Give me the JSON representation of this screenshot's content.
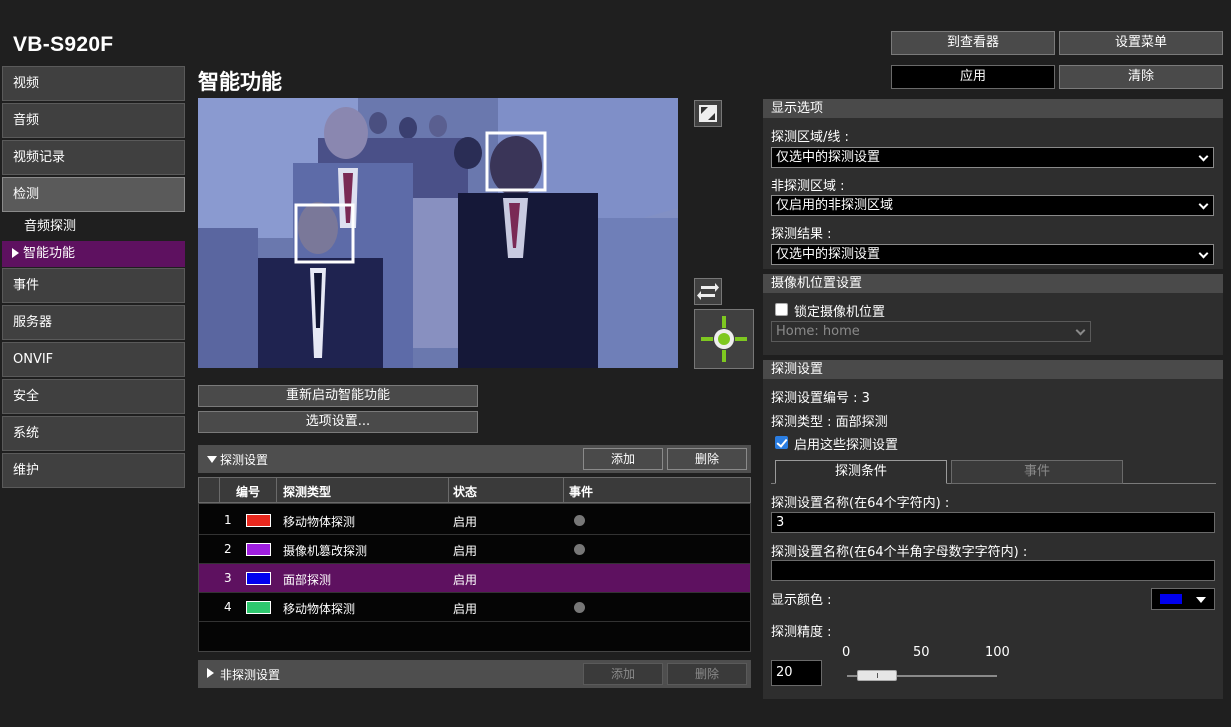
{
  "header": {
    "product": "VB-S920F",
    "page_title": "智能功能",
    "viewer_button": "到查看器",
    "settings_menu_button": "设置菜单",
    "apply_button": "应用",
    "clear_button": "清除"
  },
  "sidebar": {
    "items": [
      "视频",
      "音频",
      "视频记录",
      "检测"
    ],
    "sub_items": [
      "音频探测",
      "智能功能"
    ],
    "items_after": [
      "事件",
      "服务器",
      "ONVIF",
      "安全",
      "系统",
      "维护"
    ]
  },
  "video": {
    "restart_button": "重新启动智能功能",
    "options_button": "选项设置..."
  },
  "detection_settings": {
    "title": "探测设置",
    "add_button": "添加",
    "delete_button": "删除",
    "columns": [
      "编号",
      "探测类型",
      "状态",
      "事件"
    ],
    "rows": [
      {
        "num": "1",
        "color": "#e8281e",
        "type": "移动物体探测",
        "state": "启用",
        "event": true
      },
      {
        "num": "2",
        "color": "#a020e0",
        "type": "摄像机篡改探测",
        "state": "启用",
        "event": true
      },
      {
        "num": "3",
        "color": "#0000ee",
        "type": "面部探测",
        "state": "启用",
        "event": false
      },
      {
        "num": "4",
        "color": "#2ec86e",
        "type": "移动物体探测",
        "state": "启用",
        "event": true
      }
    ]
  },
  "non_detection": {
    "title": "非探测设置",
    "add_button": "添加",
    "delete_button": "删除"
  },
  "display_options": {
    "title": "显示选项",
    "area_label": "探测区域/线 :",
    "area_value": "仅选中的探测设置",
    "non_area_label": "非探测区域 :",
    "non_area_value": "仅启用的非探测区域",
    "result_label": "探测结果 :",
    "result_value": "仅选中的探测设置"
  },
  "camera_position": {
    "title": "摄像机位置设置",
    "lock_label": "锁定摄像机位置",
    "lock_checked": false,
    "preset_value": "Home: home"
  },
  "detect_config": {
    "title": "探测设置",
    "number_line": "探测设置编号 : 3",
    "type_line": "探测类型 : 面部探测",
    "enable_label": "启用这些探测设置",
    "enable_checked": true,
    "tab_conditions": "探测条件",
    "tab_event": "事件",
    "name_label": "探测设置名称(在64个字符内) :",
    "name_value": "3",
    "name_ascii_label": "探测设置名称(在64个半角字母数字字符内) :",
    "name_ascii_value": "",
    "color_label": "显示颜色 :",
    "color_value": "#0000ee",
    "precision_label": "探测精度 :",
    "precision_value": "20",
    "slider_ticks": [
      "0",
      "50",
      "100"
    ],
    "slider_fraction": 0.2
  }
}
